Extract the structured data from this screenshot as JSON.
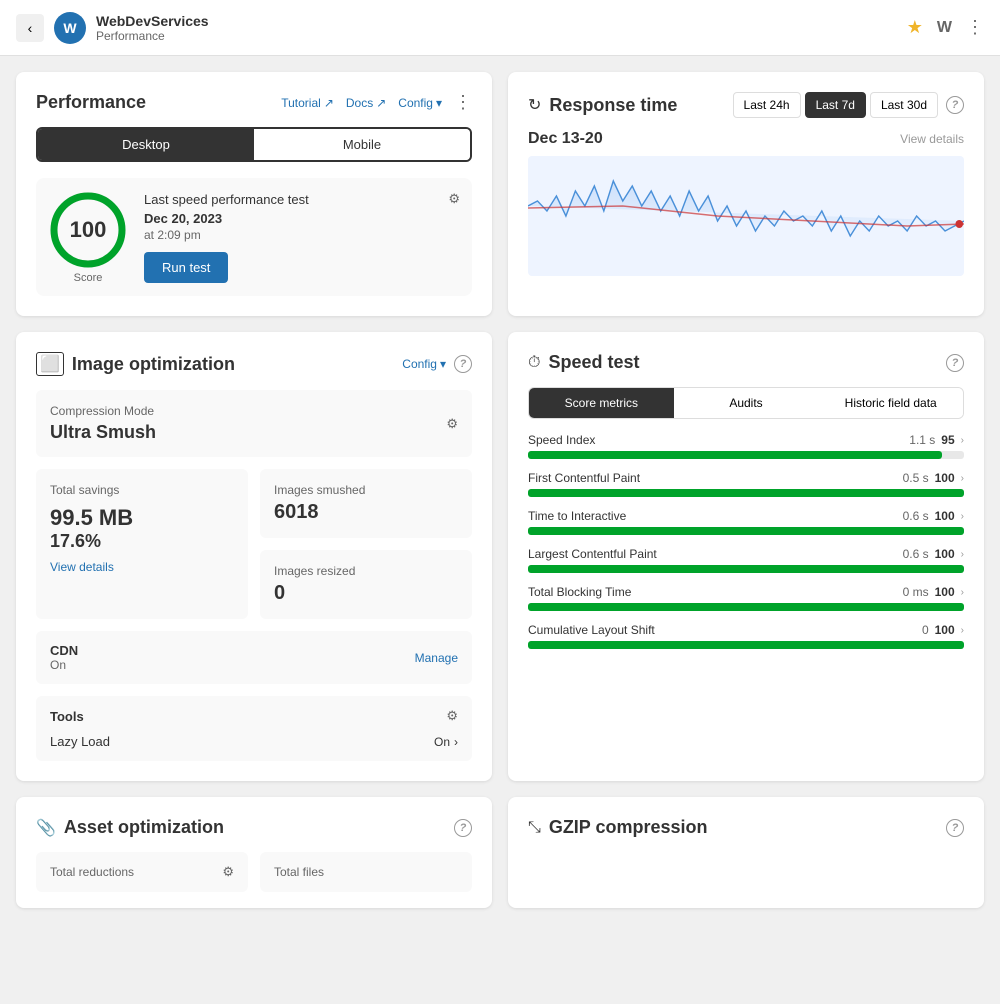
{
  "topbar": {
    "back_label": "‹",
    "avatar_label": "W",
    "site_name": "WebDevServices",
    "subtitle": "Performance",
    "star_icon": "★",
    "wp_icon": "W",
    "dots_icon": "⋮"
  },
  "performance": {
    "title": "Performance",
    "tutorial_label": "Tutorial",
    "docs_label": "Docs",
    "config_label": "Config",
    "tabs": {
      "desktop": "Desktop",
      "mobile": "Mobile"
    },
    "score": {
      "value": "100",
      "label": "Score"
    },
    "last_test": {
      "header": "Last speed performance test",
      "date": "Dec 20, 2023",
      "time": "at 2:09 pm"
    },
    "run_test_label": "Run test"
  },
  "response_time": {
    "title": "Response time",
    "tabs": [
      "Last 24h",
      "Last 7d",
      "Last 30d"
    ],
    "active_tab": "Last 7d",
    "date_range": "Dec 13-20",
    "view_details": "View details",
    "help": "?"
  },
  "image_optimization": {
    "title": "Image optimization",
    "config_label": "Config",
    "help": "?",
    "compression": {
      "label": "Compression Mode",
      "value": "Ultra Smush"
    },
    "total_savings": {
      "label": "Total savings",
      "value_mb": "99.5 MB",
      "value_pct": "17.6%",
      "view_details": "View details"
    },
    "images_smushed": {
      "label": "Images smushed",
      "value": "6018"
    },
    "images_resized": {
      "label": "Images resized",
      "value": "0"
    },
    "cdn": {
      "label": "CDN",
      "status": "On",
      "manage_label": "Manage"
    },
    "tools": {
      "label": "Tools",
      "lazy_load": {
        "label": "Lazy Load",
        "value": "On"
      }
    }
  },
  "speed_test": {
    "title": "Speed test",
    "help": "?",
    "tabs": [
      "Score metrics",
      "Audits",
      "Historic field data"
    ],
    "active_tab": "Score metrics",
    "metrics": [
      {
        "name": "Speed Index",
        "score": 95,
        "bar_pct": 95,
        "time": "1.1 s"
      },
      {
        "name": "First Contentful Paint",
        "score": 100,
        "bar_pct": 100,
        "time": "0.5 s"
      },
      {
        "name": "Time to Interactive",
        "score": 100,
        "bar_pct": 100,
        "time": "0.6 s"
      },
      {
        "name": "Largest Contentful Paint",
        "score": 100,
        "bar_pct": 100,
        "time": "0.6 s"
      },
      {
        "name": "Total Blocking Time",
        "score": 100,
        "bar_pct": 100,
        "time": "0 ms"
      },
      {
        "name": "Cumulative Layout Shift",
        "score": 100,
        "bar_pct": 100,
        "time": "0"
      }
    ]
  },
  "asset_optimization": {
    "title": "Asset optimization",
    "help": "?",
    "total_reductions_label": "Total reductions",
    "total_files_label": "Total files"
  },
  "gzip": {
    "title": "GZIP compression",
    "help": "?"
  }
}
